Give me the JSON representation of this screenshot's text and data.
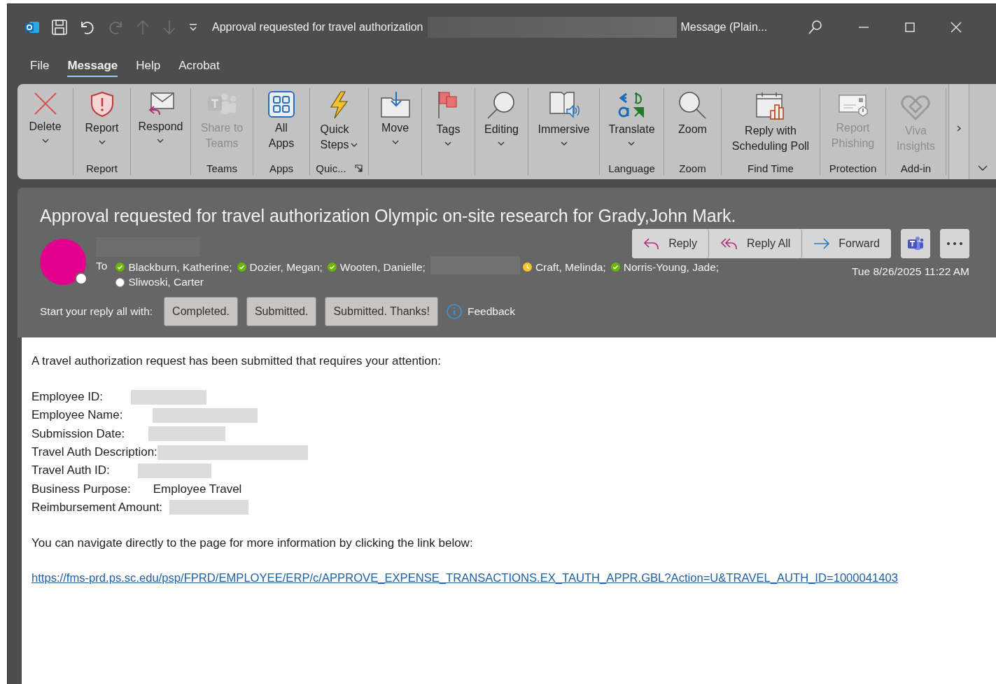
{
  "window": {
    "title": "Approval requested for travel authorization",
    "title_redacted": true,
    "subtitle": "Message (Plain..."
  },
  "menu_tabs": [
    {
      "label": "File",
      "selected": false
    },
    {
      "label": "Message",
      "selected": true
    },
    {
      "label": "Help",
      "selected": false
    },
    {
      "label": "Acrobat",
      "selected": false
    }
  ],
  "ribbon": [
    {
      "buttons": [
        {
          "lines": [
            "Delete"
          ],
          "dropdown": true,
          "disabled": false
        }
      ]
    },
    {
      "label": "Report",
      "buttons": [
        {
          "lines": [
            "Report"
          ],
          "dropdown": true,
          "disabled": false
        }
      ]
    },
    {
      "buttons": [
        {
          "lines": [
            "Respond"
          ],
          "dropdown": true,
          "disabled": false
        }
      ]
    },
    {
      "label": "Teams",
      "buttons": [
        {
          "lines": [
            "Share to",
            "Teams"
          ],
          "dropdown": false,
          "disabled": true
        }
      ]
    },
    {
      "label": "Apps",
      "buttons": [
        {
          "lines": [
            "All",
            "Apps"
          ],
          "dropdown": false,
          "disabled": false
        }
      ]
    },
    {
      "label": "Quic...",
      "launcher": true,
      "buttons": [
        {
          "lines": [
            "Quick",
            "Steps"
          ],
          "dropdown": true,
          "disabled": false
        }
      ]
    },
    {
      "buttons": [
        {
          "lines": [
            "Move"
          ],
          "dropdown": true,
          "disabled": false
        }
      ]
    },
    {
      "buttons": [
        {
          "lines": [
            "Tags"
          ],
          "dropdown": true,
          "disabled": false
        }
      ]
    },
    {
      "buttons": [
        {
          "lines": [
            "Editing"
          ],
          "dropdown": true,
          "disabled": false
        }
      ]
    },
    {
      "buttons": [
        {
          "lines": [
            "Immersive"
          ],
          "dropdown": true,
          "disabled": false
        }
      ]
    },
    {
      "label": "Language",
      "buttons": [
        {
          "lines": [
            "Translate"
          ],
          "dropdown": true,
          "disabled": false
        }
      ]
    },
    {
      "label": "Zoom",
      "buttons": [
        {
          "lines": [
            "Zoom"
          ],
          "dropdown": false,
          "disabled": false
        }
      ]
    },
    {
      "label": "Find Time",
      "buttons": [
        {
          "lines": [
            "Reply with",
            "Scheduling Poll"
          ],
          "dropdown": false,
          "disabled": false
        }
      ]
    },
    {
      "label": "Protection",
      "buttons": [
        {
          "lines": [
            "Report",
            "Phishing"
          ],
          "dropdown": false,
          "disabled": true
        }
      ]
    },
    {
      "label": "Add-in",
      "buttons": [
        {
          "lines": [
            "Viva",
            "Insights"
          ],
          "dropdown": false,
          "disabled": true
        }
      ]
    }
  ],
  "message": {
    "subject": "Approval requested for travel authorization Olympic on-site research for Grady,John Mark.",
    "sender_redacted": true,
    "to_label": "To",
    "recipients": [
      {
        "name": "Blackburn, Katherine;",
        "kind": "available"
      },
      {
        "name": "Dozier, Megan;",
        "kind": "available"
      },
      {
        "name": "Wooten, Danielle;",
        "kind": "available"
      },
      {
        "kind": "redacted"
      },
      {
        "name": "Craft, Melinda;",
        "kind": "away"
      },
      {
        "name": "Norris-Young, Jade;",
        "kind": "available"
      },
      {
        "name": "Sliwoski, Carter",
        "kind": "offline"
      }
    ],
    "date": "Tue 8/26/2025 11:22 AM",
    "actions": [
      "Reply",
      "Reply All",
      "Forward"
    ],
    "quick_reply": {
      "label": "Start your reply all with:",
      "options": [
        "Completed.",
        "Submitted.",
        "Submitted. Thanks!"
      ],
      "feedback": "Feedback"
    }
  },
  "body": {
    "intro": "A travel authorization request has been submitted that requires your attention:",
    "fields": [
      {
        "label": "Employee ID:",
        "redacted": true
      },
      {
        "label": "Employee Name:",
        "redacted": true
      },
      {
        "label": "Submission Date:",
        "redacted": true
      },
      {
        "label": "Travel Auth Description:",
        "redacted": true
      },
      {
        "label": "Travel Auth ID:",
        "redacted": true
      },
      {
        "label": "Business Purpose:",
        "value": "Employee Travel",
        "redacted": false
      },
      {
        "label": "Reimbursement Amount:",
        "redacted": true
      }
    ],
    "note": "You can navigate directly to the page for more information by clicking the link below:",
    "link": "https://fms-prd.ps.sc.edu/psp/FPRD/EMPLOYEE/ERP/c/APPROVE_EXPENSE_TRANSACTIONS.EX_TAUTH_APPR.GBL?Action=U&TRAVEL_AUTH_ID=1000041403"
  }
}
